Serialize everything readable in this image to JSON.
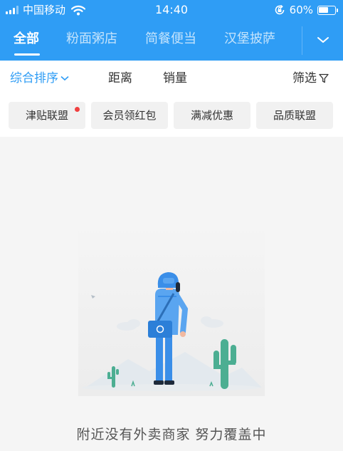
{
  "status_bar": {
    "carrier": "中国移动",
    "time": "14:40",
    "battery_percent": "60%",
    "battery_level": 0.6
  },
  "tabs": [
    {
      "label": "全部",
      "active": true
    },
    {
      "label": "粉面粥店",
      "active": false
    },
    {
      "label": "简餐便当",
      "active": false
    },
    {
      "label": "汉堡披萨",
      "active": false
    }
  ],
  "sort_bar": {
    "comprehensive": "综合排序",
    "distance": "距离",
    "sales": "销量",
    "filter": "筛选"
  },
  "chips": [
    {
      "label": "津贴联盟",
      "has_dot": true
    },
    {
      "label": "会员领红包",
      "has_dot": false
    },
    {
      "label": "满减优惠",
      "has_dot": false
    },
    {
      "label": "品质联盟",
      "has_dot": false
    }
  ],
  "empty_state": {
    "message": "附近没有外卖商家 努力覆盖中"
  },
  "colors": {
    "accent": "#2f9df5",
    "badge": "#f04040",
    "cactus": "#4cae92"
  }
}
